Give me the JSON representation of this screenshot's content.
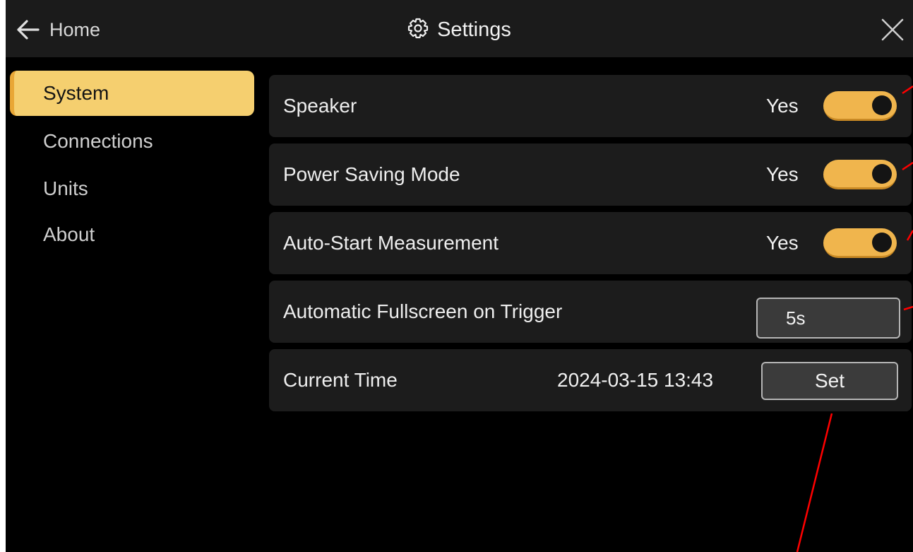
{
  "header": {
    "back_label": "Home",
    "back_icon": "arrow-left-icon",
    "title": "Settings",
    "title_icon": "gear-icon",
    "close_icon": "close-icon"
  },
  "sidebar": {
    "items": [
      {
        "label": "System",
        "active": true
      },
      {
        "label": "Connections",
        "active": false
      },
      {
        "label": "Units",
        "active": false
      },
      {
        "label": "About",
        "active": false
      }
    ]
  },
  "settings": {
    "speaker": {
      "label": "Speaker",
      "value": "Yes",
      "on": true
    },
    "power_saving": {
      "label": "Power Saving Mode",
      "value": "Yes",
      "on": true
    },
    "auto_start": {
      "label": "Auto-Start Measurement",
      "value": "Yes",
      "on": true
    },
    "auto_fullscreen": {
      "label": "Automatic Fullscreen on Trigger",
      "value": "5s"
    },
    "current_time": {
      "label": "Current Time",
      "value": "2024-03-15 13:43",
      "button_label": "Set"
    }
  },
  "colors": {
    "accent": "#f0b54d",
    "active_nav": "#f5cf6f",
    "background": "#000000",
    "panel": "#1c1c1c",
    "annotation": "#ff0000"
  }
}
